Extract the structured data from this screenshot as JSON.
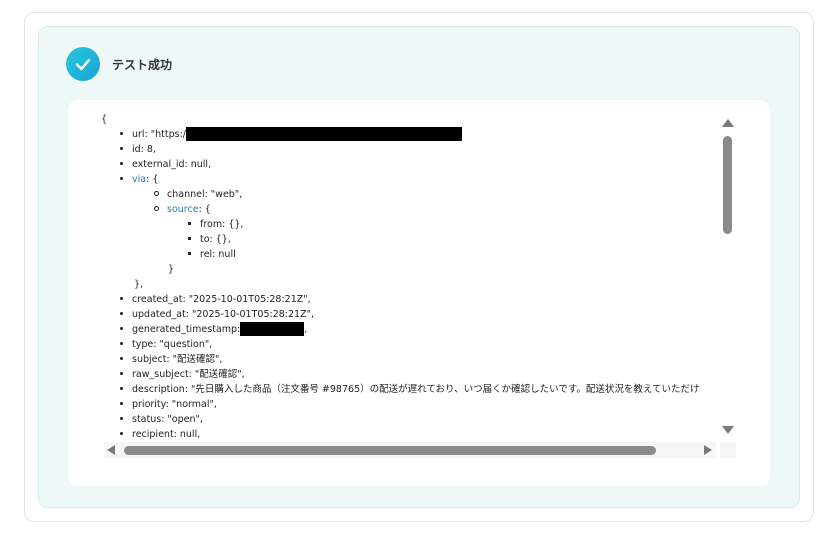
{
  "status": {
    "title": "テスト成功",
    "icon": "check-circle-icon",
    "accent_color": "#1fb6d8"
  },
  "json_view": {
    "open_brace": "{",
    "url_prefix": "url: \"https:/",
    "id": "id: 8,",
    "external_id": "external_id: null,",
    "via_key": "via",
    "via_open": ": {",
    "channel": "channel: \"web\",",
    "source_key": "source",
    "source_open": ": {",
    "from": "from: {},",
    "to": "to: {},",
    "rel": "rel: null",
    "source_close": "}",
    "via_close": "},",
    "created_at": "created_at: \"2025-10-01T05:28:21Z\",",
    "updated_at": "updated_at: \"2025-10-01T05:28:21Z\",",
    "generated_timestamp_prefix": "generated_timestamp:",
    "generated_timestamp_suffix": ",",
    "type": "type: \"question\",",
    "subject": "subject: \"配送確認\",",
    "raw_subject": "raw_subject: \"配送確認\",",
    "description": "description: \"先日購入した商品（注文番号 #98765）の配送が遅れており、いつ届くか確認したいです。配送状況を教えていただけ",
    "priority": "priority: \"normal\",",
    "status": "status: \"open\",",
    "recipient": "recipient: null,"
  }
}
